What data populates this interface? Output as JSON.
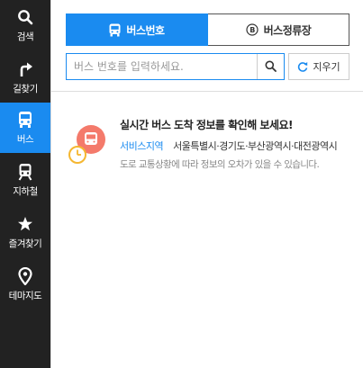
{
  "sidebar": {
    "items": [
      {
        "label": "검색",
        "icon": "search-icon",
        "active": false
      },
      {
        "label": "길찾기",
        "icon": "directions-icon",
        "active": false
      },
      {
        "label": "버스",
        "icon": "bus-icon",
        "active": true
      },
      {
        "label": "지하철",
        "icon": "subway-icon",
        "active": false
      },
      {
        "label": "즐겨찾기",
        "icon": "star-icon",
        "active": false
      },
      {
        "label": "테마지도",
        "icon": "map-pin-icon",
        "active": false
      }
    ]
  },
  "tabs": {
    "bus_number": "버스번호",
    "bus_stop": "버스정류장",
    "bus_stop_icon_letter": "B"
  },
  "search": {
    "placeholder": "버스 번호를 입력하세요.",
    "value": "",
    "clear_label": "지우기"
  },
  "info": {
    "title": "실시간 버스 도착 정보를 확인해 보세요!",
    "service_label": "서비스지역",
    "service_regions": "서울특별시·경기도·부산광역시·대전광역시",
    "note": "도로 교통상황에 따라 정보의 오차가 있을 수 있습니다."
  },
  "colors": {
    "accent": "#1a8bf0",
    "sidebar_bg": "#222222",
    "bus_icon_bg": "#f47a6b",
    "clock_color": "#f5b731"
  }
}
